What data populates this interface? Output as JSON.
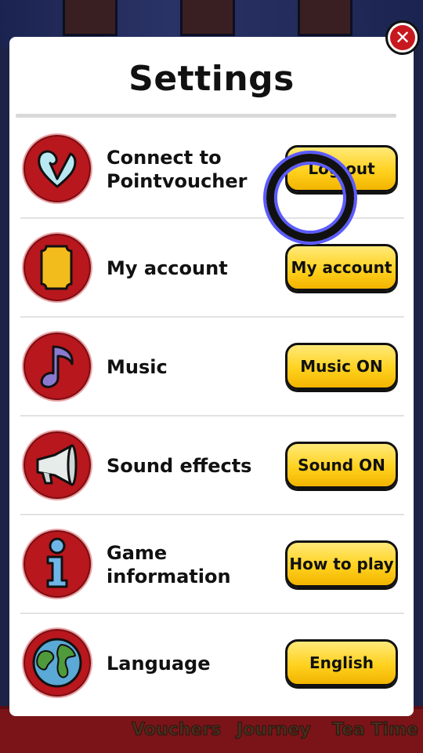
{
  "dialog": {
    "title": "Settings",
    "close_glyph": "✕"
  },
  "rows": [
    {
      "icon": "heart-v-icon",
      "label": "Connect to Pointvoucher",
      "button": "Log out"
    },
    {
      "icon": "ticket-icon",
      "label": "My account",
      "button": "My account"
    },
    {
      "icon": "music-note-icon",
      "label": "Music",
      "button": "Music ON"
    },
    {
      "icon": "megaphone-icon",
      "label": "Sound effects",
      "button": "Sound ON"
    },
    {
      "icon": "info-icon",
      "label": "Game information",
      "button": "How to play"
    },
    {
      "icon": "globe-icon",
      "label": "Language",
      "button": "English"
    }
  ],
  "background_nav": {
    "vouchers": "Vouchers",
    "journey": "Journey",
    "tea_time": "Tea Time"
  },
  "colors": {
    "icon_bg": "#b8171d",
    "button_yellow": "#ffd21f",
    "close_red": "#c8181f",
    "cursor_ring": "#5b5bff"
  }
}
